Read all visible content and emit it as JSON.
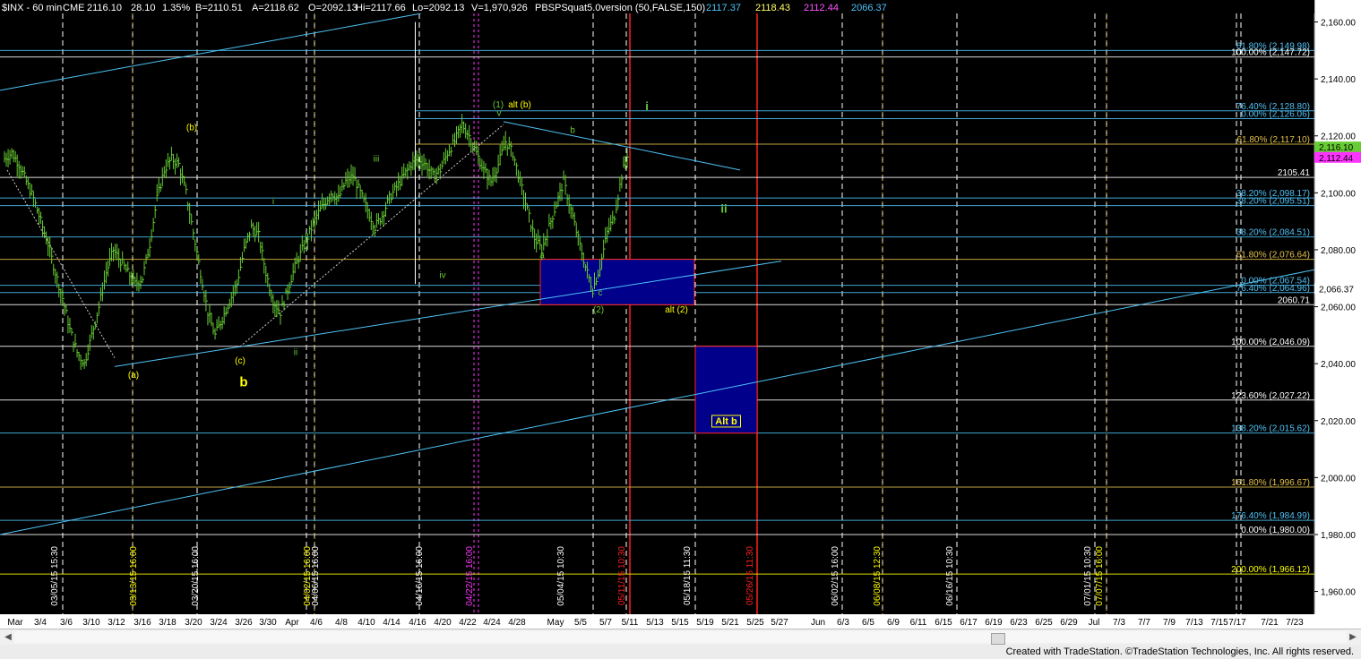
{
  "header": {
    "symbol": "$INX - 60 min",
    "exchange": "CME",
    "last": "2116.10",
    "change": "28.10",
    "change_pct": "1.35%",
    "bid": "B=2110.51",
    "ask": "A=2118.62",
    "open": "O=2092.13",
    "high": "Hi=2117.66",
    "low": "Lo=2092.13",
    "volume": "V=1,970,926",
    "indicator": "PBSPSquat5.0version (50,FALSE,150)",
    "ind_values": [
      {
        "text": "2117.37",
        "color": "#4fc3f7"
      },
      {
        "text": "2118.43",
        "color": "#ffff66"
      },
      {
        "text": "2112.44",
        "color": "#ff55ff"
      },
      {
        "text": "2066.37",
        "color": "#4fc3f7"
      }
    ]
  },
  "footer": {
    "credit": "Created with TradeStation. ©TradeStation Technologies, Inc. All rights reserved."
  },
  "colors": {
    "background": "#000000",
    "price_bars": "#66cc33",
    "trendline": "#4fc3f7",
    "grid_dashed": "#ffffff",
    "red_line": "#ff2020",
    "box_fill": "#00008b",
    "wave_yellow": "#ffff00",
    "wave_green": "#66cc33"
  },
  "chart_data": {
    "type": "bar",
    "title": "$INX - 60 min",
    "ylim": [
      1952,
      2163
    ],
    "y_ticks": [
      "2,160.00",
      "2,140.00",
      "2,120.00",
      "2,100.00",
      "2,080.00",
      "2,060.00",
      "2,040.00",
      "2,020.00",
      "2,000.00",
      "1,980.00",
      "1,960.00"
    ],
    "x_tick_labels": [
      "Mar",
      "3/4",
      "3/6",
      "3/10",
      "3/12",
      "3/16",
      "3/18",
      "3/20",
      "3/24",
      "3/26",
      "3/30",
      "Apr",
      "4/6",
      "4/8",
      "4/10",
      "4/14",
      "4/16",
      "4/20",
      "4/22",
      "4/24",
      "4/28",
      "May",
      "5/5",
      "5/7",
      "5/11",
      "5/13",
      "5/15",
      "5/19",
      "5/21",
      "5/25",
      "5/27",
      "Jun",
      "6/3",
      "6/5",
      "6/9",
      "6/11",
      "6/15",
      "6/17",
      "6/19",
      "6/23",
      "6/25",
      "6/29",
      "Jul",
      "7/3",
      "7/7",
      "7/9",
      "7/13",
      "7/15",
      "7/17",
      "7/21",
      "7/23"
    ],
    "vertical_date_labels": [
      "03/05/15 15:30",
      "03/13/15 16:00",
      "03/20/15 16:00",
      "04/02/15 16:00",
      "04/06/15 16:00",
      "04/16/15 16:00",
      "04/22/15 16:00",
      "05/04/15 10:30",
      "05/11/15 10:30",
      "05/18/15 11:30",
      "05/26/15 11:30",
      "06/02/15 16:00",
      "06/08/15 12:30",
      "06/16/15 10:30",
      "07/01/15 10:30",
      "07/07/15 16:00"
    ],
    "price_series": [
      2112,
      2114,
      2110,
      2104,
      2098,
      2090,
      2082,
      2072,
      2063,
      2052,
      2044,
      2040,
      2050,
      2060,
      2072,
      2080,
      2076,
      2072,
      2068,
      2070,
      2082,
      2098,
      2108,
      2112,
      2110,
      2100,
      2086,
      2072,
      2058,
      2050,
      2056,
      2062,
      2068,
      2080,
      2088,
      2085,
      2072,
      2062,
      2058,
      2066,
      2074,
      2080,
      2086,
      2092,
      2096,
      2100,
      2098,
      2104,
      2106,
      2100,
      2094,
      2088,
      2092,
      2098,
      2102,
      2106,
      2110,
      2112,
      2110,
      2106,
      2108,
      2114,
      2118,
      2124,
      2120,
      2114,
      2108,
      2104,
      2110,
      2118,
      2114,
      2104,
      2094,
      2084,
      2080,
      2088,
      2096,
      2104,
      2094,
      2084,
      2074,
      2066,
      2074,
      2086,
      2092,
      2106,
      2116
    ],
    "fib_levels": [
      {
        "label": "61.80% (2,149.98)",
        "value": 2149.98,
        "color": "#4fc3f7"
      },
      {
        "label": "100.00% (2,147.72)",
        "value": 2147.72,
        "color": "#ffffff"
      },
      {
        "label": "76.40% (2,128.80)",
        "value": 2128.8,
        "color": "#4fc3f7"
      },
      {
        "label": "0.00% (2,126.06)",
        "value": 2126.06,
        "color": "#4fc3f7"
      },
      {
        "label": "61.80% (2,117.10)",
        "value": 2117.1,
        "color": "#e3c04a"
      },
      {
        "label": "2105.41",
        "value": 2105.41,
        "color": "#ffffff"
      },
      {
        "label": "38.20% (2,098.17)",
        "value": 2098.17,
        "color": "#4fc3f7"
      },
      {
        "label": "38.20% (2,095.51)",
        "value": 2095.51,
        "color": "#4fc3f7"
      },
      {
        "label": "38.20% (2,084.51)",
        "value": 2084.51,
        "color": "#4fc3f7"
      },
      {
        "label": "61.80% (2,076.64)",
        "value": 2076.64,
        "color": "#e3c04a"
      },
      {
        "label": "0.00% (2,067.54)",
        "value": 2067.54,
        "color": "#4fc3f7"
      },
      {
        "label": "76.40% (2,064.96)",
        "value": 2064.96,
        "color": "#4fc3f7"
      },
      {
        "label": "2060.71",
        "value": 2060.71,
        "color": "#ffffff"
      },
      {
        "label": "100.00% (2,046.09)",
        "value": 2046.09,
        "color": "#ffffff"
      },
      {
        "label": "123.60% (2,027.22)",
        "value": 2027.22,
        "color": "#ffffff"
      },
      {
        "label": "138.20% (2,015.62)",
        "value": 2015.62,
        "color": "#4fc3f7"
      },
      {
        "label": "161.80% (1,996.67)",
        "value": 1996.67,
        "color": "#e3c04a"
      },
      {
        "label": "176.40% (1,984.99)",
        "value": 1984.99,
        "color": "#4fc3f7"
      },
      {
        "label": "0.00% (1,980.00)",
        "value": 1980.0,
        "color": "#ffffff"
      },
      {
        "label": "200.00% (1,966.12)",
        "value": 1966.12,
        "color": "#ffff00"
      }
    ],
    "price_tags": [
      {
        "label": "2,116.10",
        "value": 2116.1,
        "bg": "#66cc33",
        "fg": "#000000"
      },
      {
        "label": "2,112.44",
        "value": 2112.44,
        "bg": "#ff33ff",
        "fg": "#000000"
      },
      {
        "label": "2,066.37",
        "value": 2066.37,
        "bg": "#ffffff",
        "fg": "#000000"
      }
    ],
    "boxes": [
      {
        "label": "",
        "from_date": "05/04",
        "to_date": "05/18",
        "y_top": 2076.64,
        "y_bottom": 2060.71
      },
      {
        "label": "Alt b",
        "from_date": "05/18",
        "to_date": "05/26",
        "y_top": 2046.09,
        "y_bottom": 2015.62
      }
    ],
    "wave_labels": [
      {
        "text": "(b)",
        "color": "#ffff00"
      },
      {
        "text": "(a)",
        "color": "#ffff00"
      },
      {
        "text": "(c)",
        "color": "#ffff00"
      },
      {
        "text": "b",
        "color": "#ffff00"
      },
      {
        "text": "i",
        "color": "#66cc33"
      },
      {
        "text": "ii",
        "color": "#66cc33"
      },
      {
        "text": "iii",
        "color": "#66cc33"
      },
      {
        "text": "iv",
        "color": "#66cc33"
      },
      {
        "text": "v",
        "color": "#66cc33"
      },
      {
        "text": "(1)",
        "color": "#66cc33"
      },
      {
        "text": "alt (b)",
        "color": "#ffff00"
      },
      {
        "text": "b",
        "color": "#66cc33"
      },
      {
        "text": "a",
        "color": "#66cc33"
      },
      {
        "text": "c",
        "color": "#66cc33"
      },
      {
        "text": "(2)",
        "color": "#66cc33"
      },
      {
        "text": "alt (2)",
        "color": "#ffff00"
      },
      {
        "text": "i",
        "color": "#66cc33"
      },
      {
        "text": "ii",
        "color": "#66cc33"
      }
    ]
  }
}
